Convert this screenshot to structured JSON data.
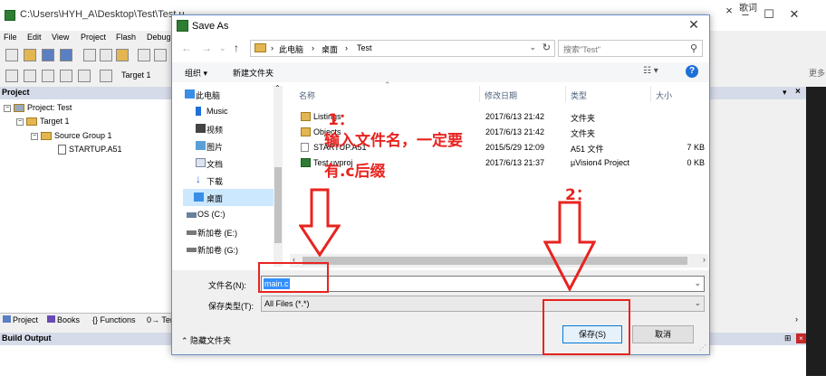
{
  "ide": {
    "title": "C:\\Users\\HYH_A\\Desktop\\Test\\Test.u",
    "menus": [
      "File",
      "Edit",
      "View",
      "Project",
      "Flash",
      "Debug"
    ],
    "target": "Target 1",
    "project_header": "Project",
    "tree": {
      "project": "Project: Test",
      "target": "Target 1",
      "group": "Source Group 1",
      "file": "STARTUP.A51"
    },
    "bottom_tabs": [
      "Project",
      "Books",
      "{} Functions",
      "0→ Ter"
    ],
    "build_output": "Build Output",
    "right_edge": "更多",
    "top_right": "歌词"
  },
  "dialog": {
    "title": "Save As",
    "breadcrumbs": [
      "此电脑",
      "桌面",
      "Test"
    ],
    "search_placeholder": "搜索\"Test\"",
    "organize": "组织 ▾",
    "new_folder": "新建文件夹",
    "nav_items": [
      "此电脑",
      "Music",
      "视频",
      "图片",
      "文档",
      "下载",
      "桌面",
      "OS (C:)",
      "新加卷 (E:)",
      "新加卷 (G:)"
    ],
    "columns": [
      "名称",
      "修改日期",
      "类型",
      "大小"
    ],
    "files": [
      {
        "name": "Listings",
        "date": "2017/6/13 21:42",
        "type": "文件夹",
        "size": ""
      },
      {
        "name": "Objects",
        "date": "2017/6/13 21:42",
        "type": "文件夹",
        "size": ""
      },
      {
        "name": "STARTUP.A51",
        "date": "2015/5/29 12:09",
        "type": "A51 文件",
        "size": "7 KB"
      },
      {
        "name": "Test.uvproj",
        "date": "2017/6/13 21:37",
        "type": "µVision4 Project",
        "size": "0 KB"
      }
    ],
    "filename_label": "文件名(N):",
    "filename_value": "main.c",
    "filetype_label": "保存类型(T):",
    "filetype_value": "All Files (*.*)",
    "hide_folders": "隐藏文件夹",
    "save_label": "保存(S)",
    "cancel_label": "取消"
  },
  "annotations": {
    "step1_number": "1：",
    "step1_line1": "输入文件名，一定要",
    "step1_line2": "有.c后缀",
    "step2_number": "2：",
    "color": "#e8231f"
  }
}
